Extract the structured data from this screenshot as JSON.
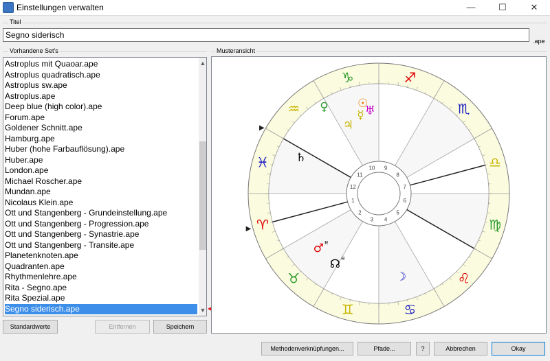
{
  "window": {
    "title": "Einstellungen verwalten",
    "minimize": "—",
    "maximize": "☐",
    "close": "✕"
  },
  "titel": {
    "group_label": "Titel",
    "value": "Segno siderisch",
    "suffix": ".ape"
  },
  "sets": {
    "group_label": "Vorhandene Set's",
    "items": [
      "Astroplus mit Quaoar.ape",
      "Astroplus quadratisch.ape",
      "Astroplus sw.ape",
      "Astroplus.ape",
      "Deep blue (high color).ape",
      "Forum.ape",
      "Goldener Schnitt.ape",
      "Hamburg.ape",
      "Huber (hohe Farbauflösung).ape",
      "Huber.ape",
      "London.ape",
      "Michael Roscher.ape",
      "Mundan.ape",
      "Nicolaus Klein.ape",
      "Ott und Stangenberg - Grundeinstellung.ape",
      "Ott und Stangenberg - Progression.ape",
      "Ott und Stangenberg - Synastrie.ape",
      "Ott und Stangenberg - Transite.ape",
      "Planetenknoten.ape",
      "Quadranten.ape",
      "Rhythmenlehre.ape",
      "Rita - Segno.ape",
      "Rita Spezial.ape",
      "Segno siderisch.ape"
    ],
    "selected_index": 23
  },
  "buttons": {
    "standardwerte": "Standardwerte",
    "entfernen": "Entfernen",
    "speichern": "Speichern",
    "methoden": "Methodenverknüpfungen...",
    "pfade": "Pfade...",
    "help": "?",
    "abbrechen": "Abbrechen",
    "okay": "Okay"
  },
  "preview": {
    "group_label": "Musteransicht",
    "house_numbers": [
      "1",
      "2",
      "3",
      "4",
      "5",
      "6",
      "7",
      "8",
      "9",
      "10",
      "11",
      "12"
    ],
    "signs": [
      {
        "name": "aries-icon",
        "glyph": "♈",
        "color": "#e00000"
      },
      {
        "name": "taurus-icon",
        "glyph": "♉",
        "color": "#2a9a2a"
      },
      {
        "name": "gemini-icon",
        "glyph": "♊",
        "color": "#c8b400"
      },
      {
        "name": "cancer-icon",
        "glyph": "♋",
        "color": "#2020c0"
      },
      {
        "name": "leo-icon",
        "glyph": "♌",
        "color": "#e00000"
      },
      {
        "name": "virgo-icon",
        "glyph": "♍",
        "color": "#2a9a2a"
      },
      {
        "name": "libra-icon",
        "glyph": "♎",
        "color": "#c8b400"
      },
      {
        "name": "scorpio-icon",
        "glyph": "♏",
        "color": "#2020c0"
      },
      {
        "name": "sagittarius-icon",
        "glyph": "♐",
        "color": "#e00000"
      },
      {
        "name": "capricorn-icon",
        "glyph": "♑",
        "color": "#2a9a2a"
      },
      {
        "name": "aquarius-icon",
        "glyph": "♒",
        "color": "#c8b400"
      },
      {
        "name": "pisces-icon",
        "glyph": "♓",
        "color": "#2020c0"
      }
    ],
    "planets": [
      {
        "name": "venus-icon",
        "glyph": "♀",
        "color": "#2a9a2a",
        "retro": ""
      },
      {
        "name": "sun-icon",
        "glyph": "☉",
        "color": "#e87800",
        "retro": ""
      },
      {
        "name": "uranus-icon",
        "glyph": "♅",
        "color": "#c800c8",
        "retro": ""
      },
      {
        "name": "mercury-icon",
        "glyph": "☿",
        "color": "#c8b400",
        "retro": ""
      },
      {
        "name": "jupiter-icon",
        "glyph": "♃",
        "color": "#c8b400",
        "retro": ""
      },
      {
        "name": "saturn-icon",
        "glyph": "♄",
        "color": "#000000",
        "retro": ""
      },
      {
        "name": "mars-icon",
        "glyph": "♂",
        "color": "#e00000",
        "retro": "R"
      },
      {
        "name": "node-icon",
        "glyph": "☊",
        "color": "#000000",
        "retro": "R"
      },
      {
        "name": "moon-icon",
        "glyph": "☽",
        "color": "#2020c0",
        "retro": ""
      }
    ]
  }
}
